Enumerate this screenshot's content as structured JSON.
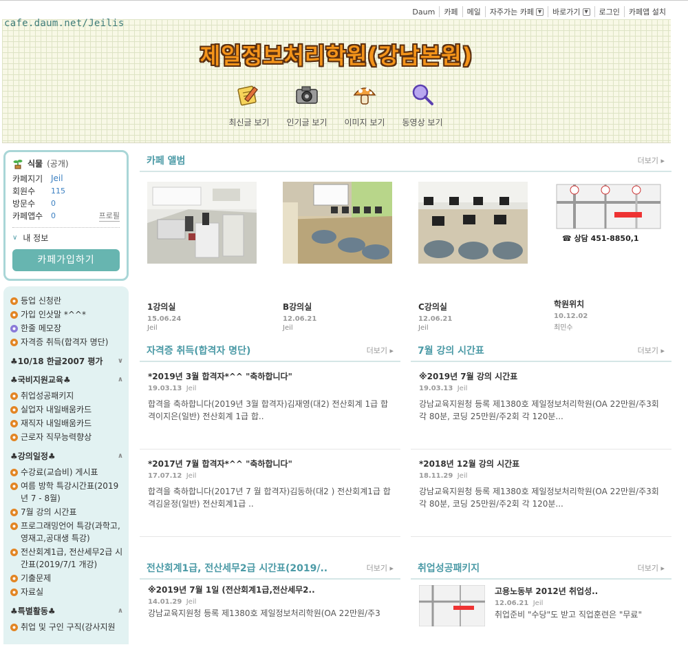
{
  "topnav": {
    "items": [
      {
        "label": "Daum",
        "dropdown": false
      },
      {
        "label": "카페",
        "dropdown": false
      },
      {
        "label": "메일",
        "dropdown": false
      },
      {
        "label": "자주가는 카페",
        "dropdown": true
      },
      {
        "label": "바로가기",
        "dropdown": true
      },
      {
        "label": "로그인",
        "dropdown": false
      },
      {
        "label": "카페앱 설치",
        "dropdown": false
      }
    ]
  },
  "header": {
    "url": "cafe.daum.net/Jeilis",
    "title": "제일정보처리학원(강남본원)",
    "quick": [
      {
        "label": "최신글 보기",
        "icon": "memo-pencil-icon"
      },
      {
        "label": "인기글 보기",
        "icon": "camera-icon"
      },
      {
        "label": "이미지 보기",
        "icon": "mushroom-icon"
      },
      {
        "label": "동영상 보기",
        "icon": "magnifier-icon"
      }
    ]
  },
  "profile": {
    "level": "식물",
    "level_sub": "(공개)",
    "rows": [
      {
        "k": "카페지기",
        "v": "Jeil"
      },
      {
        "k": "회원수",
        "v": "115"
      },
      {
        "k": "방문수",
        "v": "0"
      },
      {
        "k": "카페앱수",
        "v": "0"
      }
    ],
    "profile_link": "프로필",
    "my_info": "내 정보",
    "join": "카페가입하기"
  },
  "menu": {
    "group1": [
      "등업 신청란",
      "가입 인삿말 *^^*",
      "한줄 메모장",
      "자격증 취득(합격자 명단)"
    ],
    "head_eval": "♣10/18 한글2007 평가",
    "head_gov": "♣국비지원교육♣",
    "group_gov": [
      "취업성공패키지",
      "실업자 내일배움카드",
      "재직자 내일배움카드",
      "근로자 직무능력향상"
    ],
    "head_sched": "♣강의일정♣",
    "group_sched": [
      "수강료(교습비) 게시표",
      "여름 방학 특강시간표(2019년 7 - 8월)",
      "7월 강의 시간표",
      "프로그래밍언어 특강(과학고,영재고,공대생 특강)",
      "전산회계1급, 전산세무2급 시간표(2019/7/1 개강)",
      "기출문제",
      "자료실"
    ],
    "head_special": "♣특별활동♣",
    "group_special": [
      "취업 및 구인 구직(강사지원"
    ]
  },
  "album": {
    "title": "카페 앨범",
    "more": "더보기",
    "items": [
      {
        "name": "1강의실",
        "date": "15.06.24",
        "author": "Jeil"
      },
      {
        "name": "B강의실",
        "date": "12.06.21",
        "author": "Jeil"
      },
      {
        "name": "C강의실",
        "date": "12.06.21",
        "author": "Jeil"
      },
      {
        "name": "학원위치",
        "date": "10.12.02",
        "author": "최민수",
        "map_phone": "☎ 상담 451-8850,1"
      }
    ]
  },
  "boards": {
    "cert": {
      "title": "자격증 취득(합격자 명단)",
      "more": "더보기",
      "posts": [
        {
          "title": "*2019년 3월 합격자*^^ \"축하합니다\"",
          "date": "19.03.13",
          "author": "Jeil",
          "body": "합격을 축하합니다(2019년 3월 합격자)김재영(대2) 전산회계 1급 합격이지은(일반) 전산회계 1급 합.."
        },
        {
          "title": "*2017년 7월 합격자*^^ \"축하합니다\"",
          "date": "17.07.12",
          "author": "Jeil",
          "body": "합격을 축하합니다(2017년 7 월 합격자)김동하(대2 ) 전산회계1급 합격김윤정(일반) 전산회계1급 .."
        }
      ]
    },
    "july": {
      "title": "7월 강의 시간표",
      "more": "더보기",
      "posts": [
        {
          "title": "※2019년 7월 강의 시간표",
          "date": "19.03.13",
          "author": "Jeil",
          "body": "강남교육지원청 등록 제1380호 제일정보처리학원(OA 22만원/주3회 각 80분, 코딩 25만원/주2회 각 120분..."
        },
        {
          "title": "*2018년 12월 강의 시간표",
          "date": "18.11.29",
          "author": "Jeil",
          "body": "강남교육지원청 등록 제1380호 제일정보처리학원(OA 22만원/주3회 각 80분, 코딩 25만원/주2회 각 120분..."
        }
      ]
    },
    "acct": {
      "title": "전산회계1급, 전산세무2급 시간표(2019/..",
      "more": "더보기",
      "posts": [
        {
          "title": "※2019년 7월 1일 (전산회계1급,전산세무2..",
          "date": "14.01.29",
          "author": "Jeil",
          "body": "강남교육지원청 등록 제1380호 제일정보처리학원(OA 22만원/주3"
        }
      ]
    },
    "job": {
      "title": "취업성공패키지",
      "more": "더보기",
      "posts": [
        {
          "title": "고용노동부 2012년 취업성..",
          "date": "12.06.21",
          "author": "Jeil",
          "body": "취업준비 \"수당\"도 받고 직업훈련은 \"무료\""
        }
      ]
    }
  },
  "colors": {
    "accent": "#4b9aa6",
    "title_orange": "#f4941a",
    "sidebar_bg": "#e2f2f2",
    "join_btn": "#67b5b0"
  }
}
